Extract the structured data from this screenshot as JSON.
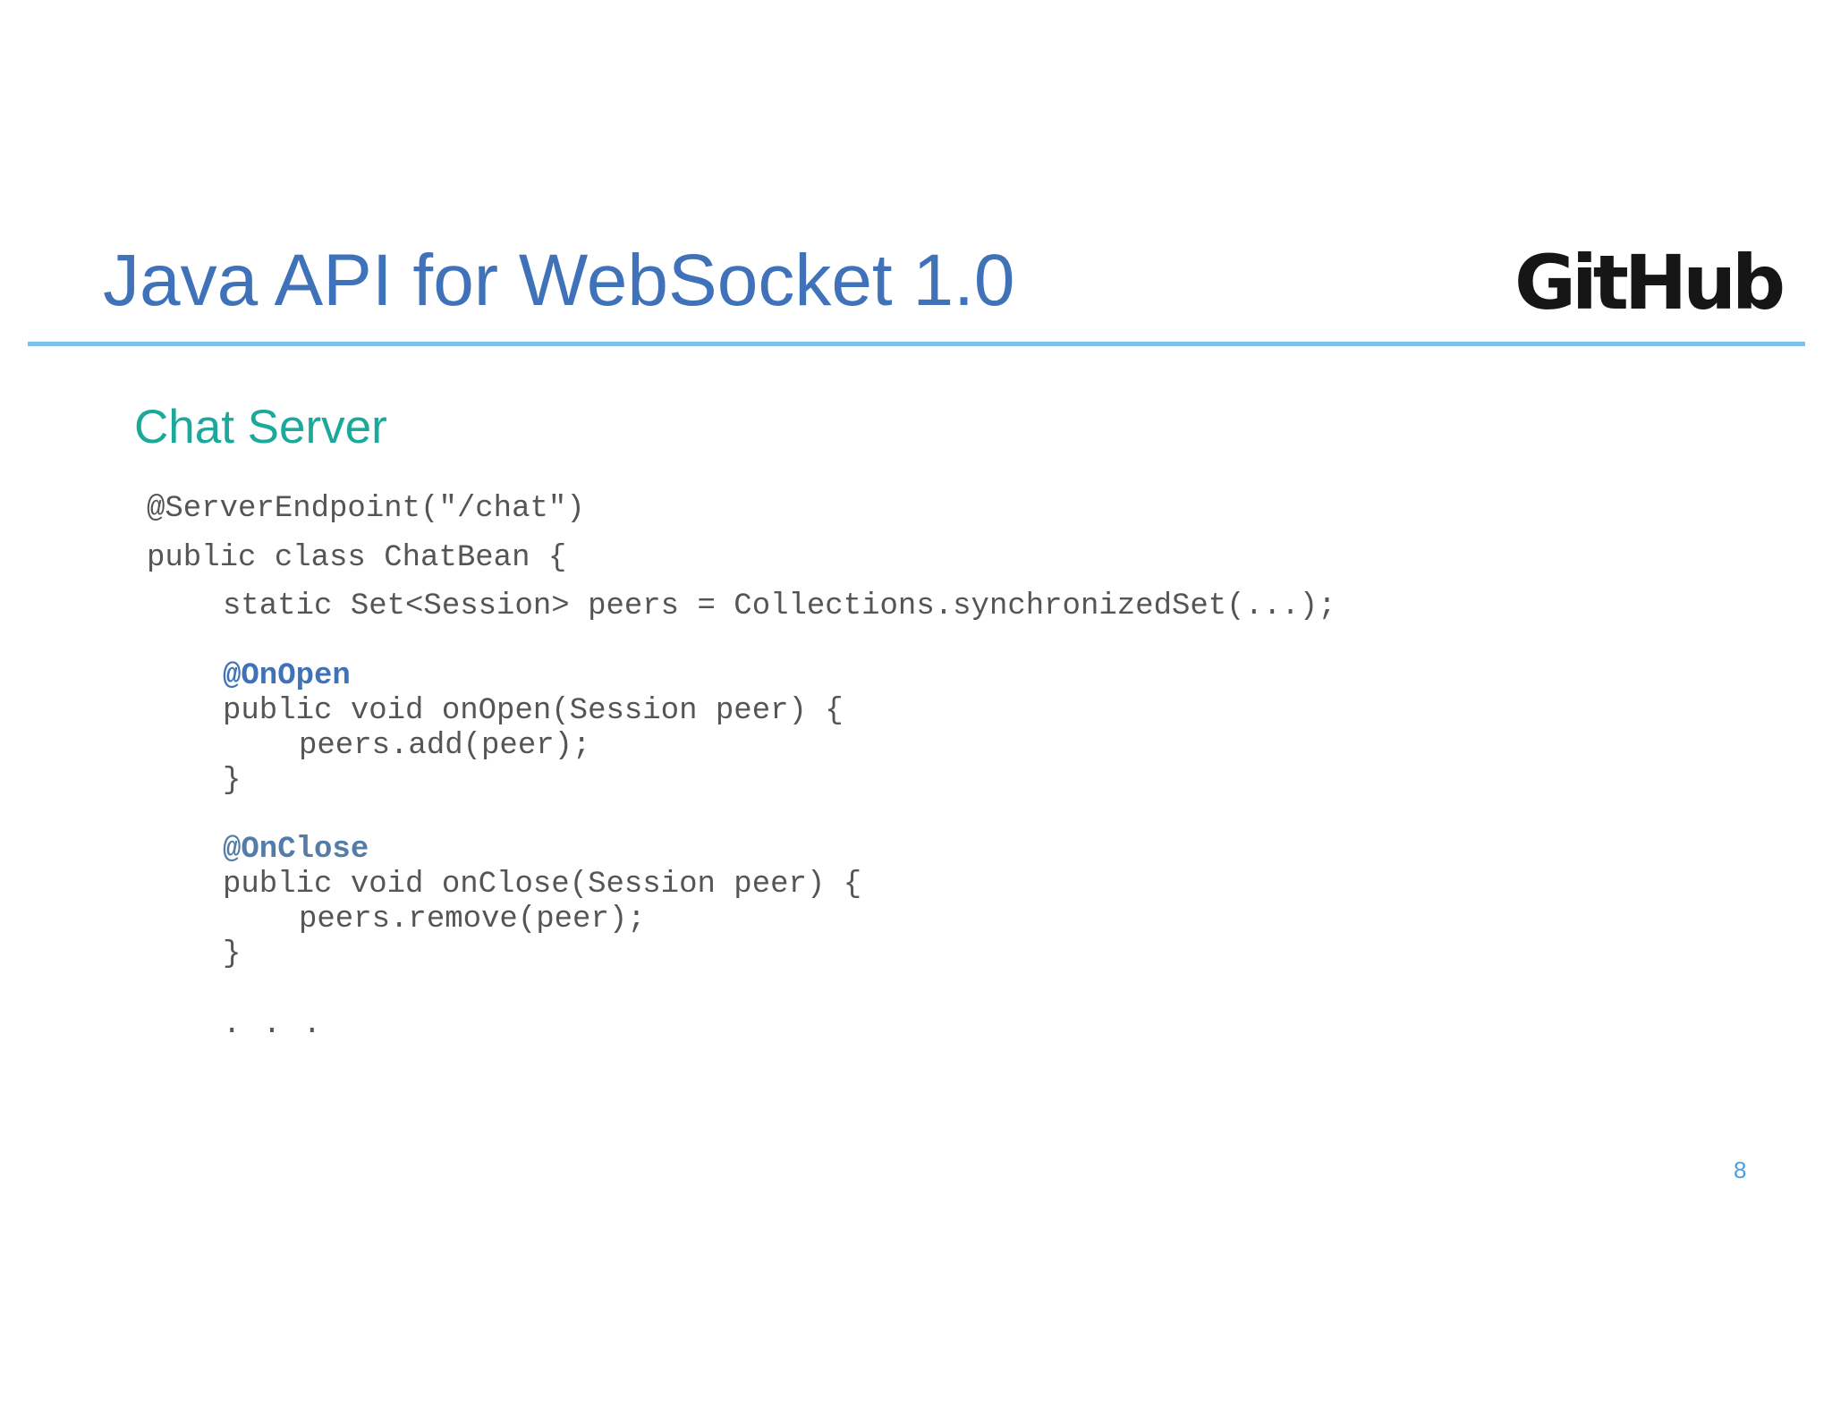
{
  "slide": {
    "title": "Java API for WebSocket 1.0",
    "logo": "GitHub",
    "subtitle": "Chat Server",
    "page_number": "8"
  },
  "code": {
    "lines": [
      "@ServerEndpoint(\"/chat\")",
      "public class ChatBean {",
      "static Set<Session> peers = Collections.synchronizedSet(...);",
      "@OnOpen",
      "public void onOpen(Session peer) {",
      "peers.add(peer);",
      "}",
      "@OnClose",
      "public void onClose(Session peer) {",
      "peers.remove(peer);",
      "}",
      ". . ."
    ]
  },
  "colors": {
    "title": "#3f72b8",
    "subtitle": "#1ca99b",
    "rule": "#7ec1ec",
    "code": "#555555",
    "annotation_open": "#3f72b8",
    "annotation_close": "#537da8",
    "page_number": "#4a9fe0",
    "logo": "#161616"
  }
}
